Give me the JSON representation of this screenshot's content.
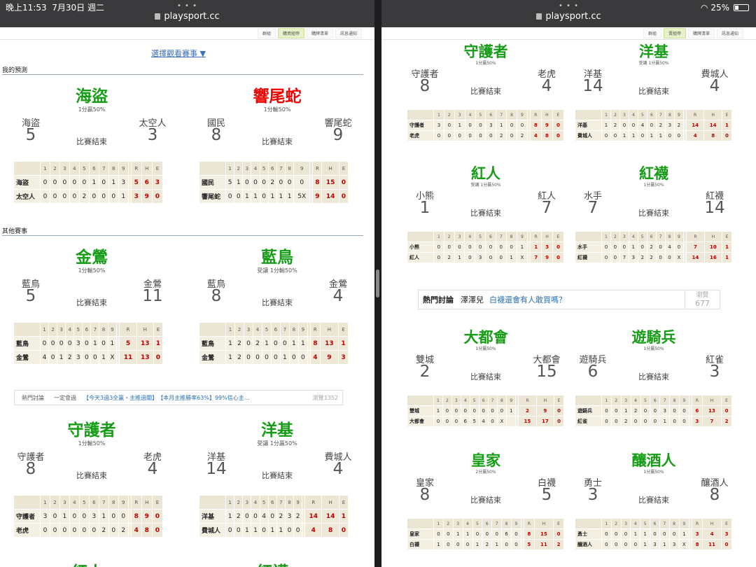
{
  "status": {
    "time": "晚上11:53",
    "date": "7月30日 週二",
    "battery": "25%"
  },
  "browser": {
    "url": "playsport.cc"
  },
  "nav": [
    "群組",
    "購買組帝",
    "購牌清單",
    "訊息通知"
  ],
  "nav_right": [
    "群組",
    "賣組帝",
    "購牌清單",
    "訊息通知"
  ],
  "select_game": "選擇觀看賽事 ▼",
  "sections": {
    "my": "我的預測",
    "other": "其他賽事"
  },
  "innings_header": [
    "",
    "1",
    "2",
    "3",
    "4",
    "5",
    "6",
    "7",
    "8",
    "9",
    "R",
    "H",
    "E"
  ],
  "games": [
    {
      "pick": "海盜",
      "pick_red": false,
      "odds": "1分贏50%",
      "away": "海盜",
      "home": "太空人",
      "as": "5",
      "hs": "3",
      "status": "比賽結束",
      "rows": [
        [
          "海盜",
          "0",
          "0",
          "0",
          "0",
          "0",
          "1",
          "0",
          "1",
          "3",
          "5",
          "6",
          "3"
        ],
        [
          "太空人",
          "0",
          "0",
          "0",
          "0",
          "2",
          "0",
          "0",
          "0",
          "1",
          "3",
          "9",
          "0"
        ]
      ]
    },
    {
      "pick": "響尾蛇",
      "pick_red": true,
      "odds": "1分輸50%",
      "away": "國民",
      "home": "響尾蛇",
      "as": "8",
      "hs": "9",
      "status": "比賽結束",
      "rows": [
        [
          "國民",
          "5",
          "1",
          "0",
          "0",
          "0",
          "2",
          "0",
          "0",
          "0",
          "8",
          "15",
          "0"
        ],
        [
          "響尾蛇",
          "0",
          "0",
          "1",
          "1",
          "0",
          "1",
          "1",
          "1",
          "5X",
          "9",
          "14",
          "0"
        ]
      ]
    },
    {
      "pick": "金鶯",
      "odds": "1分輸50%",
      "away": "藍鳥",
      "home": "金鶯",
      "as": "5",
      "hs": "11",
      "status": "比賽結束",
      "rows": [
        [
          "藍鳥",
          "0",
          "0",
          "0",
          "0",
          "3",
          "0",
          "1",
          "0",
          "1",
          "5",
          "13",
          "1"
        ],
        [
          "金鶯",
          "4",
          "0",
          "1",
          "2",
          "3",
          "0",
          "0",
          "1",
          "X",
          "11",
          "13",
          "0"
        ]
      ]
    },
    {
      "pick": "藍鳥",
      "odds": "受讓 1分輸50%",
      "away": "藍鳥",
      "home": "金鶯",
      "as": "8",
      "hs": "4",
      "status": "比賽結束",
      "rows": [
        [
          "藍鳥",
          "1",
          "2",
          "0",
          "2",
          "1",
          "0",
          "0",
          "1",
          "1",
          "8",
          "13",
          "1"
        ],
        [
          "金鶯",
          "1",
          "2",
          "0",
          "0",
          "0",
          "0",
          "1",
          "0",
          "0",
          "4",
          "9",
          "3"
        ]
      ]
    },
    {
      "pick": "守護者",
      "odds": "1分輸50%",
      "away": "守護者",
      "home": "老虎",
      "as": "8",
      "hs": "4",
      "status": "比賽結束",
      "rows": [
        [
          "守護者",
          "3",
          "0",
          "1",
          "0",
          "0",
          "3",
          "1",
          "0",
          "0",
          "8",
          "9",
          "0"
        ],
        [
          "老虎",
          "0",
          "0",
          "0",
          "0",
          "0",
          "0",
          "2",
          "0",
          "2",
          "4",
          "8",
          "0"
        ]
      ]
    },
    {
      "pick": "洋基",
      "odds": "受讓 1分贏50%",
      "away": "洋基",
      "home": "費城人",
      "as": "14",
      "hs": "4",
      "status": "比賽結束",
      "rows": [
        [
          "洋基",
          "1",
          "2",
          "0",
          "0",
          "4",
          "0",
          "2",
          "3",
          "2",
          "14",
          "14",
          "1"
        ],
        [
          "費城人",
          "0",
          "0",
          "1",
          "1",
          "0",
          "1",
          "1",
          "0",
          "0",
          "4",
          "8",
          "0"
        ]
      ]
    }
  ],
  "hot_left": {
    "label": "熱門討論",
    "tag": "一定會過",
    "link1": "【今天3過3全贏・主推過關】",
    "link2": "【本月主推勝率63%】99%信心主…",
    "views": "瀏覽1352"
  },
  "right_games": [
    {
      "pick": "守護者",
      "odds": "1分贏50%",
      "away": "守護者",
      "home": "老虎",
      "as": "8",
      "hs": "4",
      "status": "比賽結束",
      "rows": [
        [
          "守護者",
          "3",
          "0",
          "1",
          "0",
          "0",
          "3",
          "1",
          "0",
          "0",
          "8",
          "9",
          "0"
        ],
        [
          "老虎",
          "0",
          "0",
          "0",
          "0",
          "0",
          "0",
          "2",
          "0",
          "2",
          "4",
          "8",
          "0"
        ]
      ]
    },
    {
      "pick": "洋基",
      "odds": "受讓 1分贏50%",
      "away": "洋基",
      "home": "費城人",
      "as": "14",
      "hs": "4",
      "status": "比賽結束",
      "rows": [
        [
          "洋基",
          "1",
          "2",
          "0",
          "0",
          "4",
          "0",
          "2",
          "3",
          "2",
          "14",
          "14",
          "1"
        ],
        [
          "費城人",
          "0",
          "0",
          "1",
          "1",
          "0",
          "1",
          "1",
          "0",
          "0",
          "4",
          "8",
          "0"
        ]
      ]
    },
    {
      "pick": "紅人",
      "odds": "受讓 1分贏50%",
      "away": "小熊",
      "home": "紅人",
      "as": "1",
      "hs": "7",
      "status": "比賽結束",
      "rows": [
        [
          "小熊",
          "0",
          "0",
          "0",
          "0",
          "0",
          "0",
          "0",
          "0",
          "1",
          "1",
          "3",
          "0"
        ],
        [
          "紅人",
          "0",
          "2",
          "1",
          "0",
          "3",
          "0",
          "0",
          "1",
          "X",
          "7",
          "9",
          "0"
        ]
      ]
    },
    {
      "pick": "紅襪",
      "odds": "1分贏50%",
      "away": "水手",
      "home": "紅襪",
      "as": "7",
      "hs": "14",
      "status": "比賽結束",
      "rows": [
        [
          "水手",
          "0",
          "0",
          "0",
          "1",
          "0",
          "2",
          "0",
          "4",
          "0",
          "7",
          "10",
          "1"
        ],
        [
          "紅襪",
          "0",
          "0",
          "7",
          "3",
          "2",
          "2",
          "0",
          "0",
          "X",
          "14",
          "16",
          "1"
        ]
      ]
    },
    {
      "pick": "大都會",
      "odds": "1分贏50%",
      "away": "雙城",
      "home": "大都會",
      "as": "2",
      "hs": "15",
      "status": "比賽結束",
      "rows": [
        [
          "雙城",
          "1",
          "0",
          "0",
          "0",
          "0",
          "0",
          "0",
          "0",
          "1",
          "2",
          "9",
          "0"
        ],
        [
          "大都會",
          "0",
          "0",
          "0",
          "6",
          "5",
          "4",
          "0",
          "X",
          "",
          "15",
          "17",
          "0"
        ]
      ]
    },
    {
      "pick": "遊騎兵",
      "odds": "1分贏50%",
      "away": "遊騎兵",
      "home": "紅雀",
      "as": "6",
      "hs": "3",
      "status": "比賽結束",
      "rows": [
        [
          "遊騎兵",
          "0",
          "0",
          "1",
          "2",
          "0",
          "0",
          "3",
          "0",
          "0",
          "6",
          "13",
          "0"
        ],
        [
          "紅雀",
          "0",
          "0",
          "2",
          "0",
          "0",
          "0",
          "1",
          "0",
          "0",
          "3",
          "7",
          "2"
        ]
      ]
    },
    {
      "pick": "皇家",
      "odds": "2分贏50%",
      "away": "皇家",
      "home": "白襪",
      "as": "8",
      "hs": "5",
      "status": "比賽結束",
      "rows": [
        [
          "皇家",
          "0",
          "0",
          "1",
          "1",
          "0",
          "0",
          "0",
          "6",
          "0",
          "8",
          "15",
          "0"
        ],
        [
          "白襪",
          "1",
          "0",
          "0",
          "0",
          "1",
          "2",
          "1",
          "0",
          "0",
          "5",
          "11",
          "2"
        ]
      ]
    },
    {
      "pick": "釀酒人",
      "odds": "1分贏50%",
      "away": "勇士",
      "home": "釀酒人",
      "as": "3",
      "hs": "8",
      "status": "比賽結束",
      "rows": [
        [
          "勇士",
          "0",
          "0",
          "0",
          "1",
          "1",
          "0",
          "0",
          "0",
          "1",
          "3",
          "4",
          "3"
        ],
        [
          "釀酒人",
          "0",
          "0",
          "0",
          "0",
          "1",
          "3",
          "1",
          "3",
          "X",
          "8",
          "11",
          "0"
        ]
      ]
    }
  ],
  "hot_right": {
    "label": "熱門討論",
    "user": "澤澤兒",
    "link": "白襪還會有人敢買嗎？",
    "views_label": "瀏覽",
    "views": "677"
  },
  "left_bottom_peek": [
    "紅人",
    "紅襪"
  ]
}
